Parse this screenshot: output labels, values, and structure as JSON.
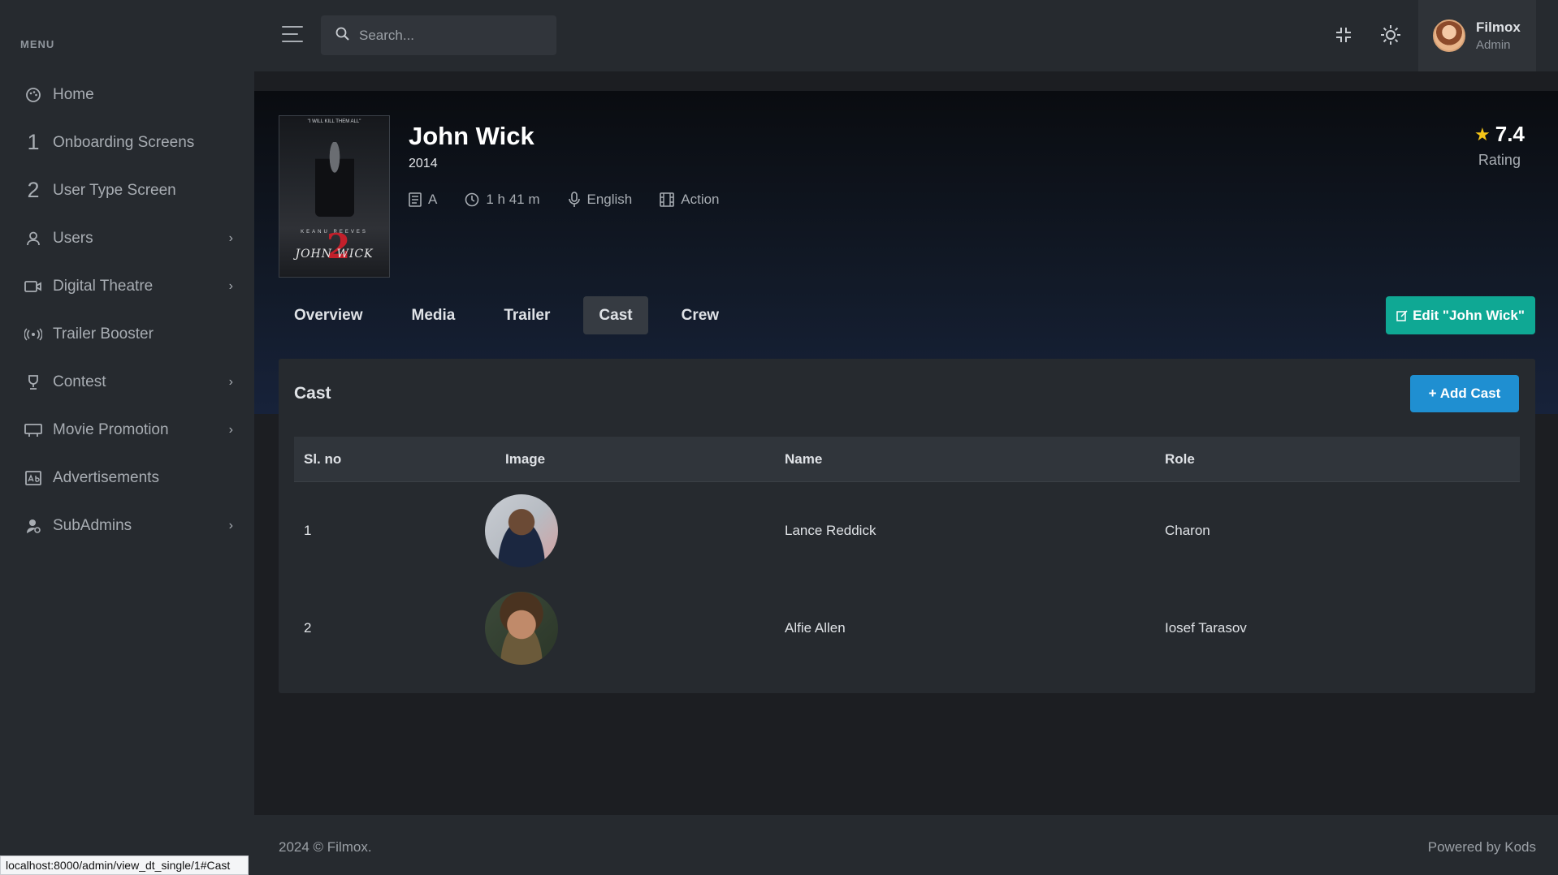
{
  "sidebar": {
    "menu_title": "MENU",
    "items": [
      {
        "label": "Home",
        "icon": "palette-icon",
        "has_children": false
      },
      {
        "label": "Onboarding Screens",
        "icon": "number-one-icon",
        "glyph": "1",
        "has_children": false
      },
      {
        "label": "User Type Screen",
        "icon": "number-two-icon",
        "glyph": "2",
        "has_children": false
      },
      {
        "label": "Users",
        "icon": "user-icon",
        "has_children": true
      },
      {
        "label": "Digital Theatre",
        "icon": "video-icon",
        "has_children": true
      },
      {
        "label": "Trailer Booster",
        "icon": "broadcast-icon",
        "has_children": false
      },
      {
        "label": "Contest",
        "icon": "trophy-icon",
        "has_children": true
      },
      {
        "label": "Movie Promotion",
        "icon": "billboard-icon",
        "has_children": true
      },
      {
        "label": "Advertisements",
        "icon": "ad-icon",
        "has_children": false
      },
      {
        "label": "SubAdmins",
        "icon": "admin-user-icon",
        "has_children": true
      }
    ]
  },
  "header": {
    "search_placeholder": "Search...",
    "profile": {
      "name": "Filmox",
      "role": "Admin"
    }
  },
  "movie": {
    "title": "John Wick",
    "year": "2014",
    "certificate": "A",
    "duration": "1 h 41 m",
    "language": "English",
    "genre": "Action",
    "rating_value": "7.4",
    "rating_label": "Rating",
    "poster": {
      "tagline": "\"I WILL KILL THEM ALL\"",
      "actor": "KEANU REEVES",
      "number": "2",
      "title": "JOHN WICK"
    }
  },
  "tabs": [
    {
      "label": "Overview",
      "active": false
    },
    {
      "label": "Media",
      "active": false
    },
    {
      "label": "Trailer",
      "active": false
    },
    {
      "label": "Cast",
      "active": true
    },
    {
      "label": "Crew",
      "active": false
    }
  ],
  "edit_button": "Edit \"John Wick\"",
  "cast": {
    "title": "Cast",
    "add_button": "+ Add Cast",
    "columns": [
      "Sl. no",
      "Image",
      "Name",
      "Role"
    ],
    "rows": [
      {
        "sl": "1",
        "name": "Lance Reddick",
        "role": "Charon"
      },
      {
        "sl": "2",
        "name": "Alfie Allen",
        "role": "Iosef Tarasov"
      }
    ]
  },
  "footer": {
    "copyright": "2024 © Filmox.",
    "powered": "Powered by Kods"
  },
  "statusbar": "localhost:8000/admin/view_dt_single/1#Cast",
  "colors": {
    "bg": "#1c1e22",
    "panel": "#262a2f",
    "accent_teal": "#0fa894",
    "accent_blue": "#1f8fd1",
    "star": "#f5c518"
  }
}
